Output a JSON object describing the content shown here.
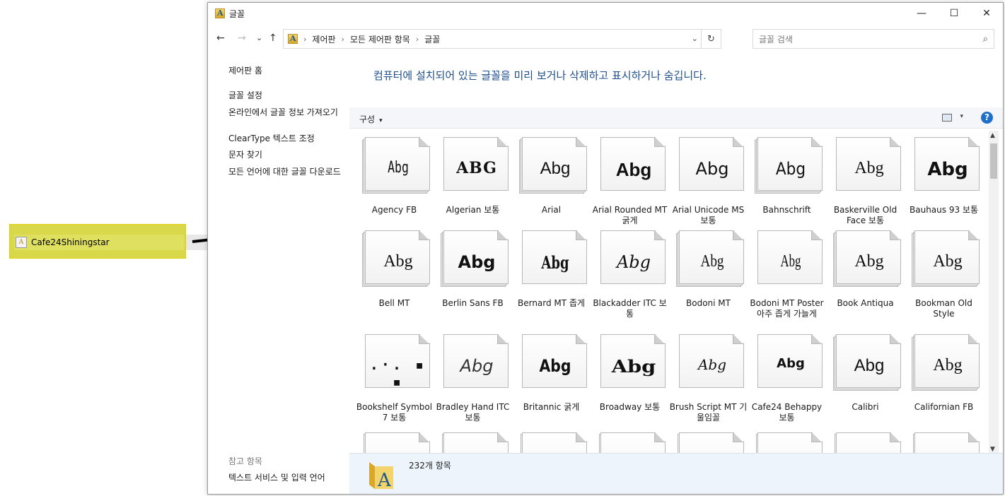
{
  "desktop": {
    "file_name": "Cafe24Shiningstar"
  },
  "window": {
    "title": "글꼴",
    "controls": {
      "minimize": "—",
      "maximize": "☐",
      "close": "✕"
    }
  },
  "nav": {
    "back": "←",
    "forward": "→",
    "recent": "⌄",
    "up": "↑"
  },
  "address": {
    "crumbs": [
      "제어판",
      "모든 제어판 항목",
      "글꼴"
    ],
    "separator": "›",
    "dropdown": "⌄",
    "refresh": "↻"
  },
  "search": {
    "placeholder": "글꼴 검색",
    "icon": "⌕"
  },
  "leftpane": {
    "home": "제어판 홈",
    "links": [
      "글꼴 설정",
      "온라인에서 글꼴 정보 가져오기",
      "ClearType 텍스트 조정",
      "문자 찾기",
      "모든 언어에 대한 글꼴 다운로드"
    ],
    "see_also_header": "참고 항목",
    "see_also": "텍스트 서비스 및 입력 언어"
  },
  "headline": "컴퓨터에 설치되어 있는 글꼴을 미리 보거나 삭제하고 표시하거나 숨깁니다.",
  "commandbar": {
    "organize": "구성",
    "dropdown": "▾",
    "help": "?"
  },
  "fonts": [
    {
      "name": "Agency FB",
      "sample": "Abg",
      "stacked": true
    },
    {
      "name": "Algerian 보통",
      "sample": "ABG",
      "stacked": false
    },
    {
      "name": "Arial",
      "sample": "Abg",
      "stacked": true
    },
    {
      "name": "Arial Rounded MT 굵게",
      "sample": "Abg",
      "stacked": false
    },
    {
      "name": "Arial Unicode MS 보통",
      "sample": "Abg",
      "stacked": false
    },
    {
      "name": "Bahnschrift",
      "sample": "Abg",
      "stacked": true
    },
    {
      "name": "Baskerville Old Face 보통",
      "sample": "Abg",
      "stacked": false
    },
    {
      "name": "Bauhaus 93 보통",
      "sample": "Abg",
      "stacked": false
    },
    {
      "name": "Bell MT",
      "sample": "Abg",
      "stacked": true
    },
    {
      "name": "Berlin Sans FB",
      "sample": "Abg",
      "stacked": true
    },
    {
      "name": "Bernard MT 좁게",
      "sample": "Abg",
      "stacked": false
    },
    {
      "name": "Blackadder ITC 보통",
      "sample": "Abg",
      "stacked": false
    },
    {
      "name": "Bodoni MT",
      "sample": "Abg",
      "stacked": true
    },
    {
      "name": "Bodoni MT Poster 아주 좁게 가늘게",
      "sample": "Abg",
      "stacked": false
    },
    {
      "name": "Book Antiqua",
      "sample": "Abg",
      "stacked": true
    },
    {
      "name": "Bookman Old Style",
      "sample": "Abg",
      "stacked": true
    },
    {
      "name": "Bookshelf Symbol 7 보통",
      "sample": ".·. ▪ ▪",
      "stacked": false
    },
    {
      "name": "Bradley Hand ITC 보통",
      "sample": "Abg",
      "stacked": false
    },
    {
      "name": "Britannic 굵게",
      "sample": "Abg",
      "stacked": false
    },
    {
      "name": "Broadway 보통",
      "sample": "Abg",
      "stacked": false
    },
    {
      "name": "Brush Script MT 기울임꼴",
      "sample": "Abg",
      "stacked": false
    },
    {
      "name": "Cafe24 Behappy 보통",
      "sample": "Abg",
      "stacked": false
    },
    {
      "name": "Calibri",
      "sample": "Abg",
      "stacked": true
    },
    {
      "name": "Californian FB",
      "sample": "Abg",
      "stacked": true
    }
  ],
  "status": {
    "count": "232개 항목"
  },
  "scrollbar": {
    "up": "▲",
    "down": "▼"
  },
  "colors": {
    "headline": "#1e4e8c",
    "highlight": "#e0e060",
    "help": "#1f6fc9"
  }
}
